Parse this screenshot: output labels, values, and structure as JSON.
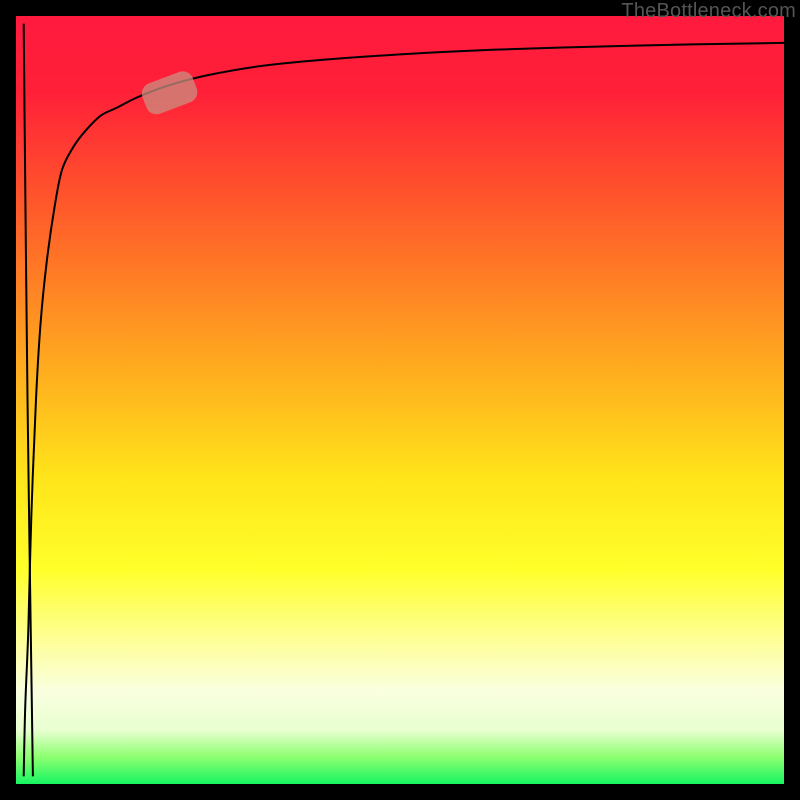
{
  "attribution": "TheBottleneck.com",
  "chart_data": {
    "type": "line",
    "title": "",
    "xlabel": "",
    "ylabel": "",
    "xlim": [
      0,
      100
    ],
    "ylim": [
      0,
      100
    ],
    "gradient_stops": [
      {
        "offset": 0.0,
        "color": "#ff1a3e"
      },
      {
        "offset": 0.1,
        "color": "#ff2038"
      },
      {
        "offset": 0.25,
        "color": "#ff5a2a"
      },
      {
        "offset": 0.45,
        "color": "#ffa81f"
      },
      {
        "offset": 0.6,
        "color": "#ffe41a"
      },
      {
        "offset": 0.72,
        "color": "#ffff2a"
      },
      {
        "offset": 0.82,
        "color": "#feffa0"
      },
      {
        "offset": 0.88,
        "color": "#f9ffe0"
      },
      {
        "offset": 0.93,
        "color": "#e8ffd0"
      },
      {
        "offset": 0.965,
        "color": "#8cff70"
      },
      {
        "offset": 1.0,
        "color": "#17f562"
      }
    ],
    "series": [
      {
        "name": "bottleneck-curve",
        "x": [
          1.0,
          1.2,
          1.6,
          2.0,
          2.6,
          3.2,
          4.0,
          5.0,
          6.0,
          7.5,
          9.0,
          11,
          13,
          16,
          20,
          25,
          32,
          40,
          50,
          62,
          75,
          88,
          100
        ],
        "y": [
          1,
          10,
          20,
          35,
          50,
          60,
          68,
          75,
          80,
          83,
          85,
          87,
          88,
          89.5,
          91,
          92.3,
          93.5,
          94.3,
          95.0,
          95.6,
          96.0,
          96.3,
          96.5
        ]
      },
      {
        "name": "initial-drop",
        "x": [
          1.0,
          1.5,
          2.2
        ],
        "y": [
          99,
          50,
          1
        ]
      }
    ],
    "marker": {
      "series": "bottleneck-curve",
      "x": 20,
      "y": 90,
      "color": "#c98f82",
      "length": 7,
      "thickness": 4.2
    }
  }
}
